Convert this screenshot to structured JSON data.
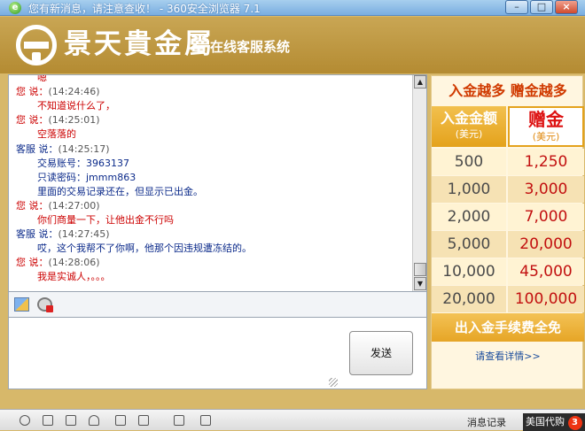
{
  "browser": {
    "title": "您有新消息，请注意查收！ - 360安全浏览器 7.1",
    "logo_glyph": "e",
    "controls": {
      "minimize": "–",
      "maximize": "□",
      "close": "×"
    }
  },
  "banner": {
    "brand": "景天貴金屬",
    "subtitle": "在线客服系统",
    "brand_color": "#b48b32"
  },
  "chat": {
    "messages": [
      {
        "kind": "body",
        "role": "you",
        "text": "嗯"
      },
      {
        "kind": "head",
        "role": "you",
        "name": "您 说：",
        "time": "(14:24:46)"
      },
      {
        "kind": "body",
        "role": "you",
        "text": "不知道说什么了，"
      },
      {
        "kind": "head",
        "role": "you",
        "name": "您 说：",
        "time": "(14:25:01)"
      },
      {
        "kind": "body",
        "role": "you",
        "text": "空落落的"
      },
      {
        "kind": "head",
        "role": "cs",
        "name": "客服 说：",
        "time": "(14:25:17)"
      },
      {
        "kind": "body",
        "role": "cs",
        "text": "交易账号：3963137"
      },
      {
        "kind": "body",
        "role": "cs",
        "text": "只读密码：jmmm863"
      },
      {
        "kind": "body",
        "role": "cs",
        "text": "里面的交易记录还在，但显示已出金。"
      },
      {
        "kind": "head",
        "role": "you",
        "name": "您 说：",
        "time": "(14:27:00)"
      },
      {
        "kind": "body",
        "role": "you",
        "text": "你们商量一下，让他出金不行吗"
      },
      {
        "kind": "head",
        "role": "cs",
        "name": "客服 说：",
        "time": "(14:27:45)"
      },
      {
        "kind": "body",
        "role": "cs",
        "text": "哎，这个我帮不了你啊，他那个因违规遭冻结的。"
      },
      {
        "kind": "head",
        "role": "you",
        "name": "您 说：",
        "time": "(14:28:06)"
      },
      {
        "kind": "body",
        "role": "you",
        "text": "我是实诚人，。。。"
      }
    ],
    "scroll": {
      "up": "▲",
      "down": "▼"
    }
  },
  "input": {
    "value": "",
    "send_label": "发送"
  },
  "promo": {
    "headline": "入金越多  赠金越多",
    "deposit_header": "入金金额",
    "bonus_header": "赠金",
    "unit": "(美元)",
    "rows": [
      {
        "deposit": "500",
        "bonus": "1,250"
      },
      {
        "deposit": "1,000",
        "bonus": "3,000"
      },
      {
        "deposit": "2,000",
        "bonus": "7,000"
      },
      {
        "deposit": "5,000",
        "bonus": "20,000"
      },
      {
        "deposit": "10,000",
        "bonus": "45,000"
      },
      {
        "deposit": "20,000",
        "bonus": "100,000"
      }
    ],
    "footer": "出入金手续费全免",
    "details_link": "请查看详情>>"
  },
  "statusbar": {
    "history_text": "消息记录",
    "news_text": "美国代购",
    "news_badge": "3"
  }
}
